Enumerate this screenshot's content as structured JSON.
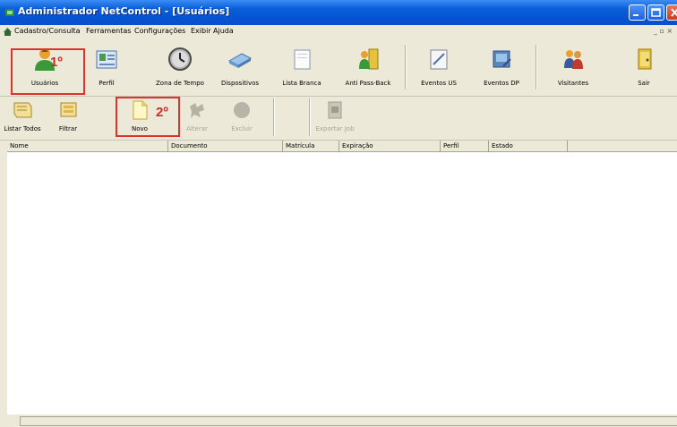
{
  "window": {
    "title": "Administrador NetControl - [Usuários]"
  },
  "menu": {
    "items": [
      "Cadastro/Consulta",
      "Ferramentas",
      "Configurações",
      "Exibir",
      "Ajuda"
    ],
    "mdi_controls": "_ ▫ ×"
  },
  "toolbar": {
    "buttons": [
      {
        "label": "Usuários",
        "icon": "user-icon"
      },
      {
        "label": "Perfil",
        "icon": "profile-card-icon"
      },
      {
        "label": "Zona de Tempo",
        "icon": "clock-icon"
      },
      {
        "label": "Dispositivos",
        "icon": "device-icon"
      },
      {
        "label": "Lista Branca",
        "icon": "whitelist-icon"
      },
      {
        "label": "Anti Pass-Back",
        "icon": "anti-passback-icon"
      },
      {
        "label": "Eventos US",
        "icon": "events-us-icon"
      },
      {
        "label": "Eventos DP",
        "icon": "events-dp-icon"
      },
      {
        "label": "Visitantes",
        "icon": "visitors-icon"
      },
      {
        "label": "Sair",
        "icon": "exit-door-icon"
      }
    ]
  },
  "subtoolbar": {
    "buttons": [
      {
        "label": "Listar Todos",
        "icon": "list-all-icon",
        "enabled": true
      },
      {
        "label": "Filtrar",
        "icon": "filter-icon",
        "enabled": true
      },
      {
        "label": "Novo",
        "icon": "new-document-icon",
        "enabled": true
      },
      {
        "label": "Alterar",
        "icon": "edit-icon",
        "enabled": false
      },
      {
        "label": "Excluir",
        "icon": "delete-icon",
        "enabled": false
      },
      {
        "label": "Exportar Job",
        "icon": "export-icon",
        "enabled": false
      }
    ]
  },
  "annotations": {
    "step1": "1º",
    "step2": "2º",
    "color": "#e0312d"
  },
  "table": {
    "columns": [
      "Nome",
      "Documento",
      "Matrícula",
      "Expiração",
      "Perfil",
      "Estado"
    ],
    "rows": []
  },
  "colors": {
    "titlebar": "#0554d4",
    "chrome": "#ece9d8",
    "highlight": "#e0312d"
  }
}
